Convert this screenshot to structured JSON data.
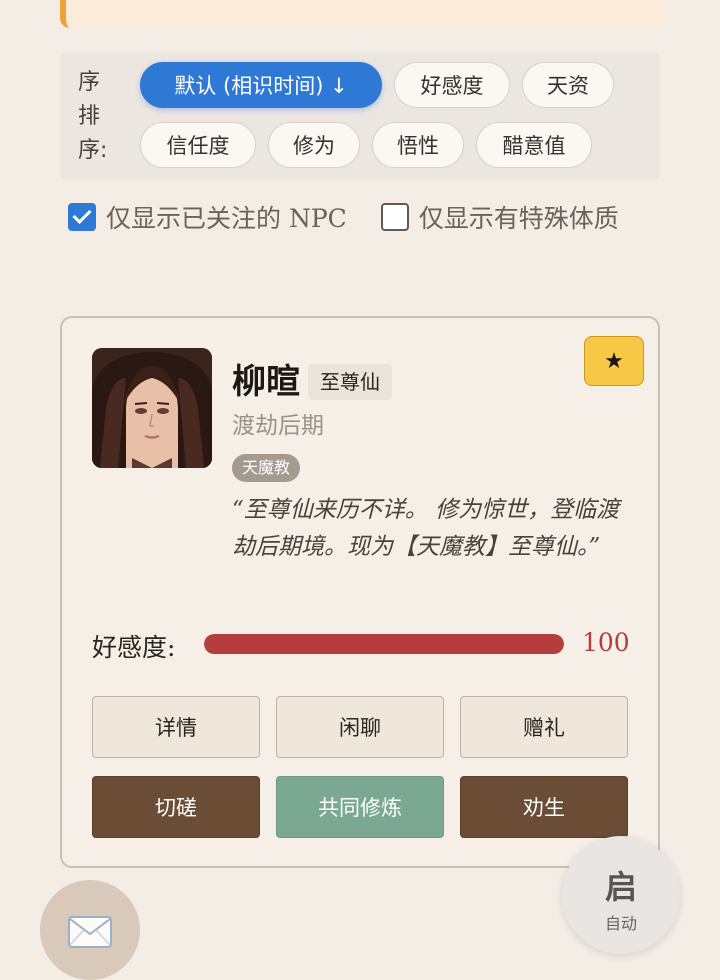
{
  "sort": {
    "label": "序\n排\n序:",
    "options": [
      {
        "label": "默认 (相识时间) ↓",
        "active": true
      },
      {
        "label": "好感度",
        "active": false
      },
      {
        "label": "天资",
        "active": false
      },
      {
        "label": "信任度",
        "active": false
      },
      {
        "label": "修为",
        "active": false
      },
      {
        "label": "悟性",
        "active": false
      },
      {
        "label": "醋意值",
        "active": false
      }
    ]
  },
  "filters": {
    "followed_only": {
      "label": "仅显示已关注的 NPC",
      "checked": true
    },
    "special_only": {
      "label": "仅显示有特殊体质",
      "checked": false
    }
  },
  "npc": {
    "name": "柳暄",
    "title": "至尊仙",
    "realm": "渡劫后期",
    "sect": "天魔教",
    "favorite_icon": "★",
    "quote": "“至尊仙来历不详。 修为惊世，登临渡劫后期境。现为【天魔教】至尊仙。”",
    "affinity_label": "好感度:",
    "affinity_value": "100",
    "affinity_percent": 100,
    "actions": [
      "详情",
      "闲聊",
      "赠礼",
      "切磋",
      "共同修炼",
      "劝生"
    ]
  },
  "fab": {
    "mail_icon": "envelope-icon",
    "auto_main": "启",
    "auto_sub": "自动"
  }
}
